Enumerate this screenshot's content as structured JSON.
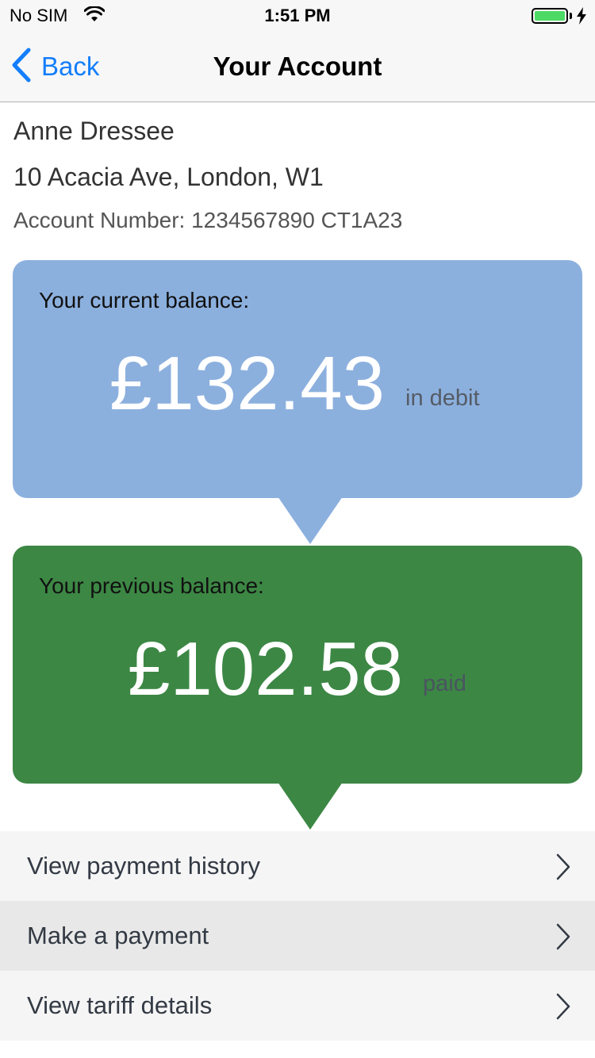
{
  "status_bar": {
    "carrier": "No SIM",
    "time": "1:51 PM",
    "battery_level": 1.0,
    "charging": true
  },
  "nav": {
    "back_label": "Back",
    "title": "Your Account"
  },
  "account": {
    "name": "Anne Dressee",
    "address": "10 Acacia Ave, London, W1",
    "number_line": "Account Number: 1234567890 CT1A23"
  },
  "current_balance": {
    "label": "Your current balance:",
    "amount": "£132.43",
    "status": "in debit",
    "color": "#8cb0de"
  },
  "previous_balance": {
    "label": "Your previous balance:",
    "amount": "£102.58",
    "status": "paid",
    "color": "#3c8744"
  },
  "menu": {
    "items": [
      {
        "label": "View payment history"
      },
      {
        "label": "Make a payment"
      },
      {
        "label": "View tariff details"
      }
    ]
  },
  "colors": {
    "accent": "#147efb",
    "battery": "#4cd964"
  }
}
